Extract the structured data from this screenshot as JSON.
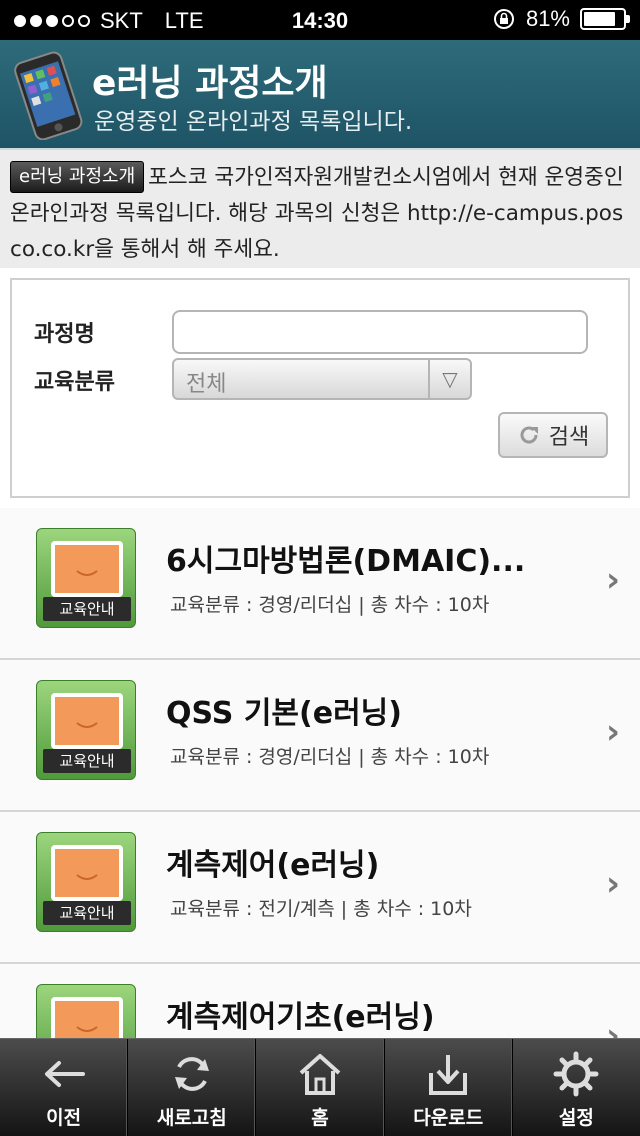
{
  "status_bar": {
    "carrier": "SKT",
    "network": "LTE",
    "time": "14:30",
    "battery": "81%",
    "battery_level": 0.81,
    "signal_bars_filled": 3,
    "signal_bars_total": 5
  },
  "header": {
    "title": "e러닝 과정소개",
    "subtitle": "운영중인 온라인과정 목록입니다."
  },
  "intro": {
    "badge": "e러닝 과정소개",
    "text": "포스코 국가인적자원개발컨소시엄에서 현재 운영중인 온라인과정 목록입니다. 해당 과목의 신청은 http://e-campus.posco.co.kr을 통해서 해 주세요."
  },
  "search": {
    "name_label": "과정명",
    "name_value": "",
    "category_label": "교육분류",
    "category_selected": "전체",
    "button_label": "검색"
  },
  "courses": [
    {
      "title": "6시그마방법론(DMAIC)...",
      "meta": "교육분류 : 경영/리더십 | 총 차수 : 10차",
      "thumb_label": "교육안내"
    },
    {
      "title": "QSS 기본(e러닝)",
      "meta": "교육분류 : 경영/리더십 | 총 차수 : 10차",
      "thumb_label": "교육안내"
    },
    {
      "title": "계측제어(e러닝)",
      "meta": "교육분류 : 전기/계측 | 총 차수 : 10차",
      "thumb_label": "교육안내"
    },
    {
      "title": "계측제어기초(e러닝)",
      "meta": "",
      "thumb_label": ""
    }
  ],
  "tab_bar": {
    "items": [
      {
        "label": "이전",
        "icon": "back-arrow-icon"
      },
      {
        "label": "새로고침",
        "icon": "refresh-icon"
      },
      {
        "label": "홈",
        "icon": "home-icon"
      },
      {
        "label": "다운로드",
        "icon": "download-icon"
      },
      {
        "label": "설정",
        "icon": "gear-icon"
      }
    ]
  },
  "colors": {
    "header_bg": "#1e5466",
    "thumb_green": "#6bb34f",
    "thumb_screen": "#f39a5a"
  }
}
